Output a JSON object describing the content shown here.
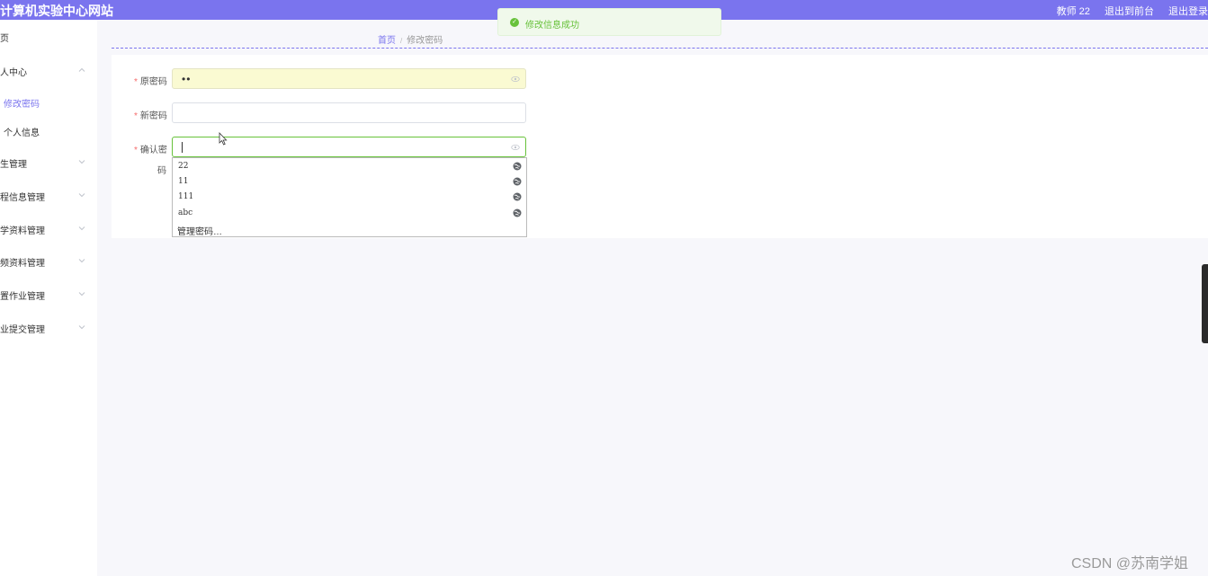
{
  "header": {
    "site_title": "计算机实验中心网站",
    "user": "教师 22",
    "back_front": "退出到前台",
    "logout": "退出登录"
  },
  "toast": {
    "message": "修改信息成功",
    "status_color": "#67c23a"
  },
  "sidebar": {
    "items": [
      {
        "label": "页"
      },
      {
        "label": "人中心",
        "expanded": true
      },
      {
        "label": "生管理"
      },
      {
        "label": "程信息管理"
      },
      {
        "label": "学资料管理"
      },
      {
        "label": "频资料管理"
      },
      {
        "label": "置作业管理"
      },
      {
        "label": "业提交管理"
      }
    ],
    "sub_items": [
      {
        "label": "修改密码",
        "active": true
      },
      {
        "label": "个人信息"
      }
    ]
  },
  "breadcrumb": {
    "home": "首页",
    "separator": "/",
    "current": "修改密码"
  },
  "form": {
    "old_password": {
      "label": "原密码",
      "value": "••",
      "required": true
    },
    "new_password": {
      "label": "新密码",
      "value": "",
      "required": true
    },
    "confirm_password": {
      "label": "确认密",
      "label_wrap": "码",
      "value": "",
      "required": true
    }
  },
  "autocomplete": {
    "items": [
      "22",
      "11",
      "111",
      "abc"
    ],
    "manage": "管理密码…"
  },
  "watermark": "CSDN @苏南学姐",
  "colors": {
    "accent": "#7a74ee",
    "success": "#67c23a",
    "required": "#f56c6c"
  }
}
